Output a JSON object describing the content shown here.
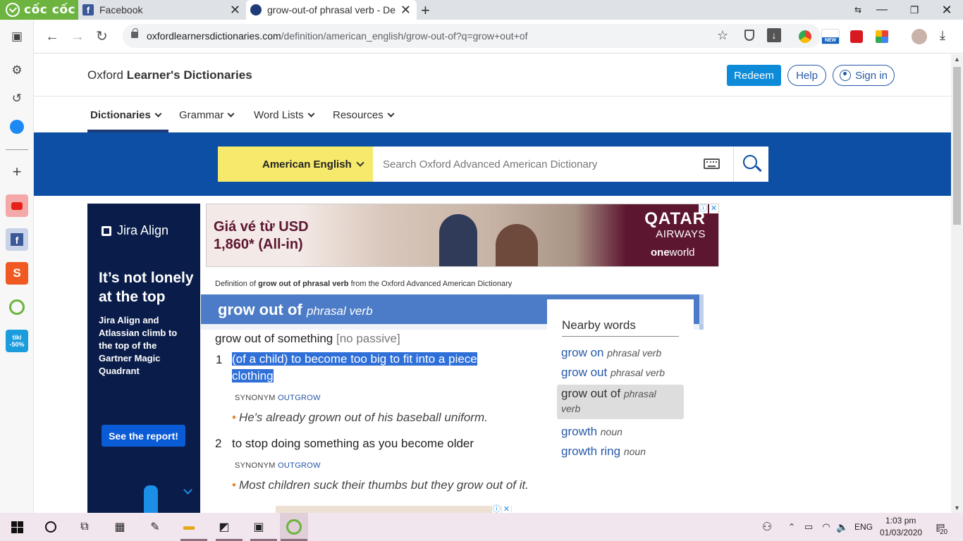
{
  "browser": {
    "brand": "cốc cốc",
    "tabs": [
      {
        "title": "Facebook",
        "active": false
      },
      {
        "title": "grow-out-of phrasal verb - De",
        "active": true
      }
    ],
    "url_host": "oxfordlearnersdictionaries.com",
    "url_path": "/definition/american_english/grow-out-of?q=grow+out+of",
    "ext_badge_new": "NEW"
  },
  "sidebar": {
    "badge_tiki": "tiki",
    "badge_discount": "-50%"
  },
  "site": {
    "logo_prefix": "Oxford ",
    "logo_bold": "Learner's Dictionaries",
    "redeem": "Redeem",
    "help": "Help",
    "signin": "Sign in",
    "nav": [
      "Dictionaries",
      "Grammar",
      "Word Lists",
      "Resources"
    ],
    "dict_select": "American English",
    "search_placeholder": "Search Oxford Advanced American Dictionary"
  },
  "left_ad": {
    "brand": "Jira Align",
    "headline": "It’s not lonely at the top",
    "body": "Jira Align and Atlassian climb to the top of the Gartner Magic Quadrant",
    "cta": "See the report!"
  },
  "top_ad": {
    "price": "Giá vé từ USD 1,860* (All-in)",
    "brand": "QATAR",
    "brand_sub": "AIRWAYS",
    "alliance_bold": "one",
    "alliance": "world"
  },
  "entry": {
    "source_prefix": "Definition of ",
    "source_bold": "grow out of phrasal verb",
    "source_suffix": " from the Oxford Advanced American Dictionary",
    "headword": "grow out of",
    "pos": "phrasal verb",
    "pattern": "grow out of something",
    "pattern_note": "[no passive]",
    "senses": [
      {
        "num": "1",
        "def_line1": "(of a child) to become too big to fit into a piece of",
        "def_line2": "clothing",
        "syn_label": "SYNONYM",
        "syn": "OUTGROW",
        "example": "He's already grown out of his baseball uniform."
      },
      {
        "num": "2",
        "def": "to stop doing something as you become older",
        "syn_label": "SYNONYM",
        "syn": "OUTGROW",
        "example": "Most children suck their thumbs but they grow out of it."
      }
    ]
  },
  "nearby": {
    "title": "Nearby words",
    "items": [
      {
        "word": "grow on",
        "pos": "phrasal verb"
      },
      {
        "word": "grow out",
        "pos": "phrasal verb"
      },
      {
        "word": "grow out of",
        "pos": "phrasal",
        "pos2": "verb"
      },
      {
        "word": "growth",
        "pos": "noun"
      },
      {
        "word": "growth ring",
        "pos": "noun"
      }
    ]
  },
  "taskbar": {
    "lang": "ENG",
    "time": "1:03 pm",
    "date": "01/03/2020",
    "notif_count": "20"
  }
}
